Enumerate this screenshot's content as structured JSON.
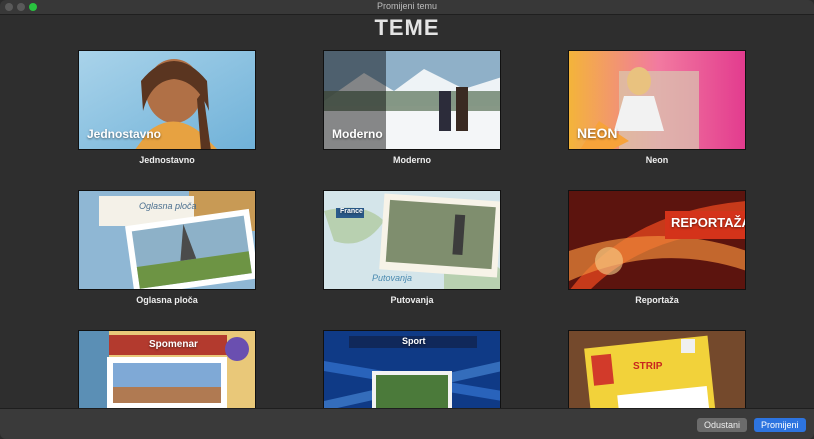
{
  "window": {
    "title": "Promijeni temu"
  },
  "heading": "TEME",
  "themes": [
    {
      "name": "Jednostavno",
      "thumb_label": "Jednostavno"
    },
    {
      "name": "Moderno",
      "thumb_label": "Moderno"
    },
    {
      "name": "Neon",
      "thumb_label": "NEON"
    },
    {
      "name": "Oglasna ploča",
      "thumb_label": "Oglasna ploča"
    },
    {
      "name": "Putovanja",
      "thumb_label": "Putovanja",
      "tag": "France"
    },
    {
      "name": "Reportaža",
      "thumb_label": "REPORTAŽA"
    },
    {
      "name": "",
      "thumb_label": "Spomenar"
    },
    {
      "name": "",
      "thumb_label": "Sport"
    },
    {
      "name": "",
      "thumb_label": "STRIP"
    }
  ],
  "buttons": {
    "cancel": "Odustani",
    "change": "Promijeni"
  }
}
